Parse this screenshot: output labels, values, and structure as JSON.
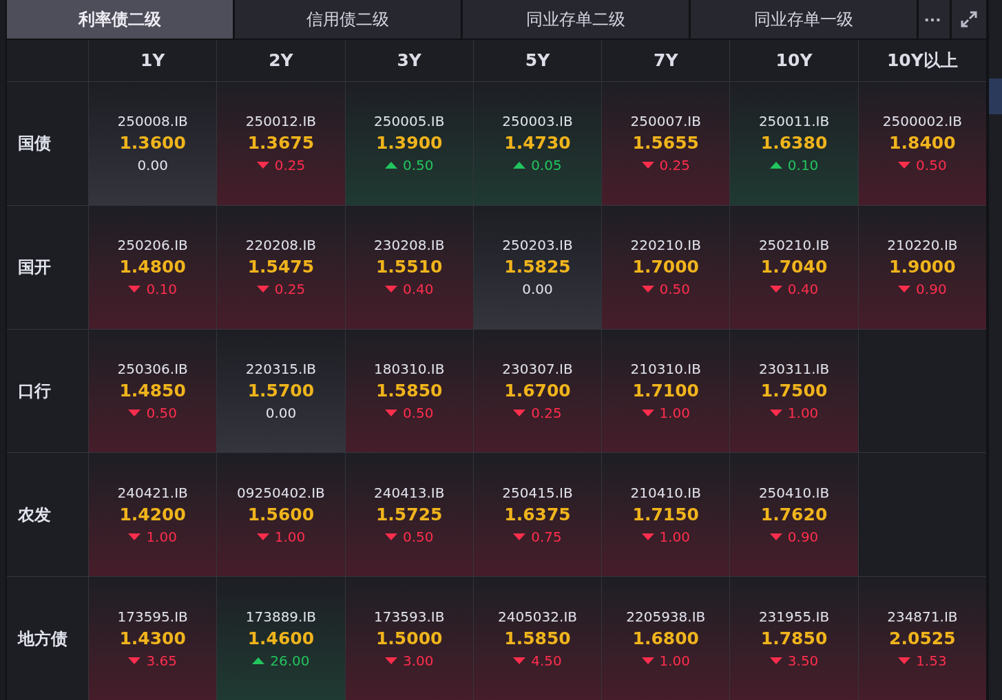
{
  "tabs": [
    {
      "label": "利率债二级",
      "selected": true
    },
    {
      "label": "信用债二级",
      "selected": false
    },
    {
      "label": "同业存单二级",
      "selected": false
    },
    {
      "label": "同业存单一级",
      "selected": false
    }
  ],
  "more_button": "···",
  "table": {
    "columns": [
      "1Y",
      "2Y",
      "3Y",
      "5Y",
      "7Y",
      "10Y",
      "10Y以上"
    ],
    "rows": [
      {
        "label": "国债",
        "cells": [
          {
            "code": "250008.IB",
            "yield": "1.3600",
            "change": "0.00",
            "kind": "flat"
          },
          {
            "code": "250012.IB",
            "yield": "1.3675",
            "change": "0.25",
            "kind": "down"
          },
          {
            "code": "250005.IB",
            "yield": "1.3900",
            "change": "0.50",
            "kind": "up"
          },
          {
            "code": "250003.IB",
            "yield": "1.4730",
            "change": "0.05",
            "kind": "up"
          },
          {
            "code": "250007.IB",
            "yield": "1.5655",
            "change": "0.25",
            "kind": "down"
          },
          {
            "code": "250011.IB",
            "yield": "1.6380",
            "change": "0.10",
            "kind": "up"
          },
          {
            "code": "2500002.IB",
            "yield": "1.8400",
            "change": "0.50",
            "kind": "down"
          }
        ]
      },
      {
        "label": "国开",
        "cells": [
          {
            "code": "250206.IB",
            "yield": "1.4800",
            "change": "0.10",
            "kind": "down"
          },
          {
            "code": "220208.IB",
            "yield": "1.5475",
            "change": "0.25",
            "kind": "down"
          },
          {
            "code": "230208.IB",
            "yield": "1.5510",
            "change": "0.40",
            "kind": "down"
          },
          {
            "code": "250203.IB",
            "yield": "1.5825",
            "change": "0.00",
            "kind": "flat"
          },
          {
            "code": "220210.IB",
            "yield": "1.7000",
            "change": "0.50",
            "kind": "down"
          },
          {
            "code": "250210.IB",
            "yield": "1.7040",
            "change": "0.40",
            "kind": "down"
          },
          {
            "code": "210220.IB",
            "yield": "1.9000",
            "change": "0.90",
            "kind": "down"
          }
        ]
      },
      {
        "label": "口行",
        "cells": [
          {
            "code": "250306.IB",
            "yield": "1.4850",
            "change": "0.50",
            "kind": "down"
          },
          {
            "code": "220315.IB",
            "yield": "1.5700",
            "change": "0.00",
            "kind": "flat"
          },
          {
            "code": "180310.IB",
            "yield": "1.5850",
            "change": "0.50",
            "kind": "down"
          },
          {
            "code": "230307.IB",
            "yield": "1.6700",
            "change": "0.25",
            "kind": "down"
          },
          {
            "code": "210310.IB",
            "yield": "1.7100",
            "change": "1.00",
            "kind": "down"
          },
          {
            "code": "230311.IB",
            "yield": "1.7500",
            "change": "1.00",
            "kind": "down"
          },
          null
        ]
      },
      {
        "label": "农发",
        "cells": [
          {
            "code": "240421.IB",
            "yield": "1.4200",
            "change": "1.00",
            "kind": "down"
          },
          {
            "code": "09250402.IB",
            "yield": "1.5600",
            "change": "1.00",
            "kind": "down"
          },
          {
            "code": "240413.IB",
            "yield": "1.5725",
            "change": "0.50",
            "kind": "down"
          },
          {
            "code": "250415.IB",
            "yield": "1.6375",
            "change": "0.75",
            "kind": "down"
          },
          {
            "code": "210410.IB",
            "yield": "1.7150",
            "change": "1.00",
            "kind": "down"
          },
          {
            "code": "250410.IB",
            "yield": "1.7620",
            "change": "0.90",
            "kind": "down"
          },
          null
        ]
      },
      {
        "label": "地方债",
        "cells": [
          {
            "code": "173595.IB",
            "yield": "1.4300",
            "change": "3.65",
            "kind": "down"
          },
          {
            "code": "173889.IB",
            "yield": "1.4600",
            "change": "26.00",
            "kind": "up"
          },
          {
            "code": "173593.IB",
            "yield": "1.5000",
            "change": "3.00",
            "kind": "down"
          },
          {
            "code": "2405032.IB",
            "yield": "1.5850",
            "change": "4.50",
            "kind": "down"
          },
          {
            "code": "2205938.IB",
            "yield": "1.6800",
            "change": "1.00",
            "kind": "down"
          },
          {
            "code": "231955.IB",
            "yield": "1.7850",
            "change": "3.50",
            "kind": "down"
          },
          {
            "code": "234871.IB",
            "yield": "2.0525",
            "change": "1.53",
            "kind": "down"
          }
        ]
      }
    ]
  }
}
